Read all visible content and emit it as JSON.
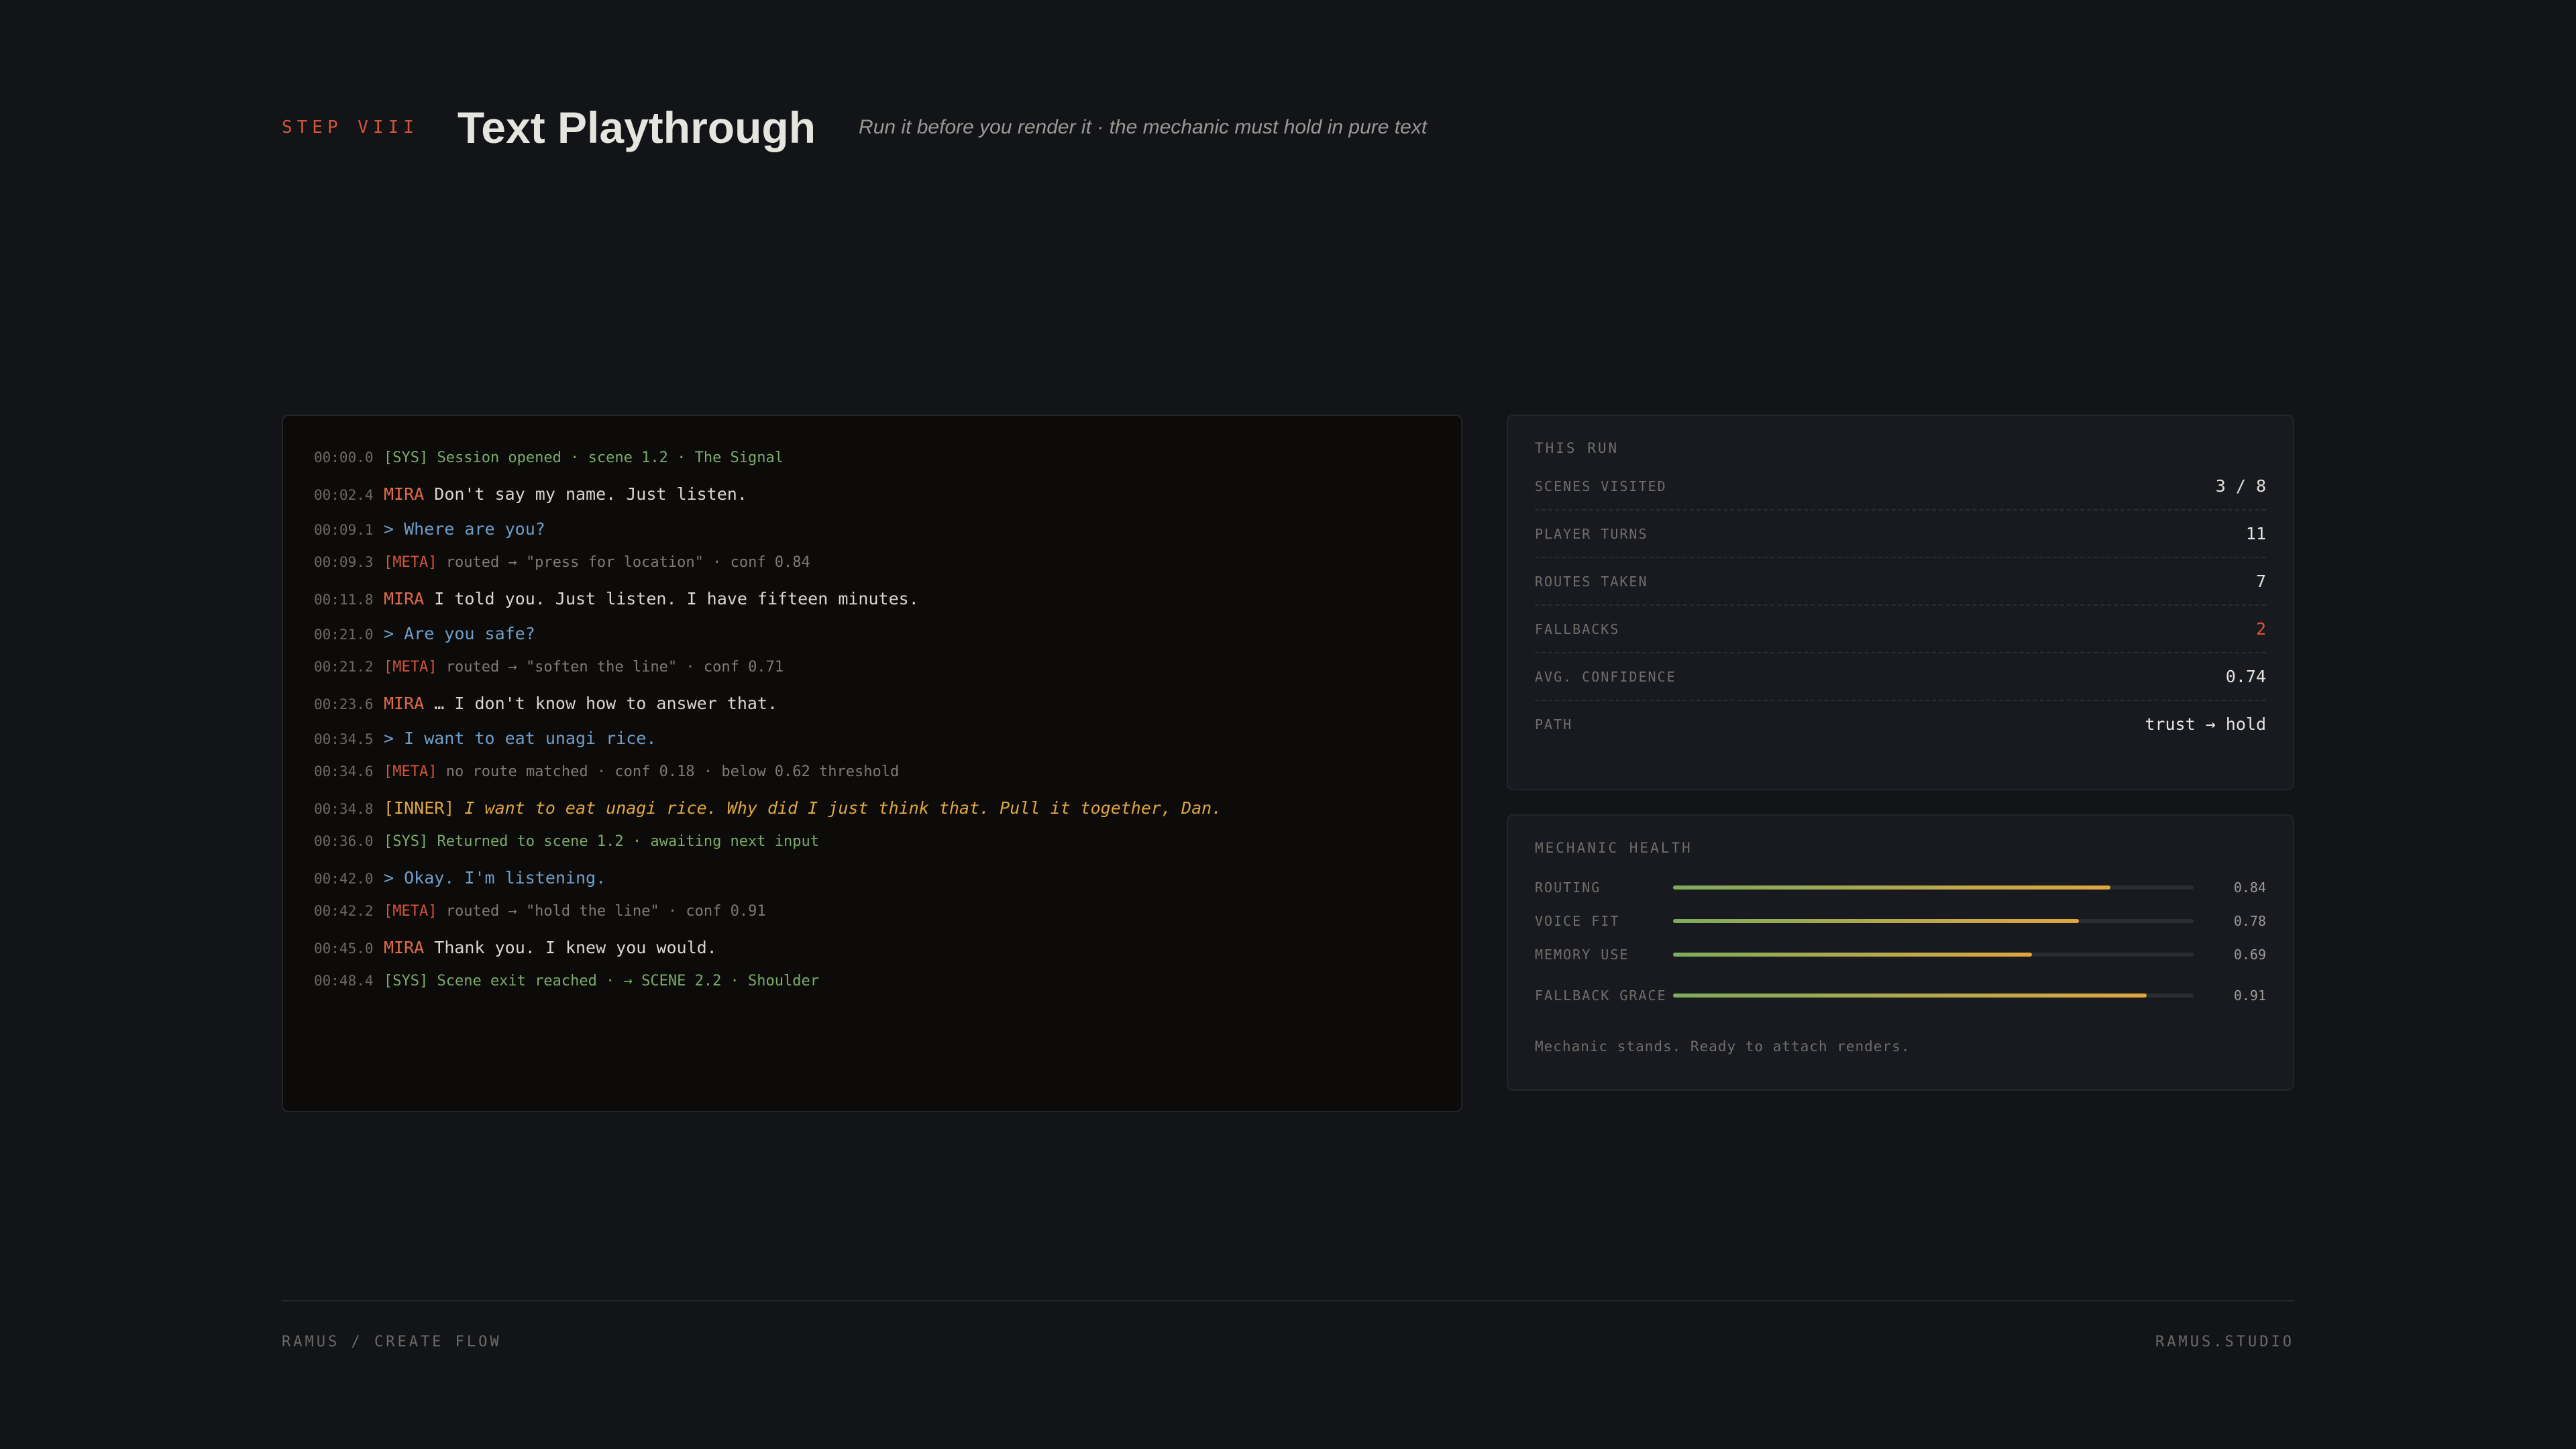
{
  "header": {
    "step": "STEP VIII",
    "title": "Text Playthrough",
    "subtitle": "Run it before you render it · the mechanic must hold in pure text"
  },
  "log": [
    {
      "ts": "00:00.0",
      "type": "sys",
      "text": "[SYS] Session opened · scene 1.2 · The Signal"
    },
    {
      "ts": "00:02.4",
      "type": "mira",
      "speaker": "MIRA",
      "text": "Don't say my name. Just listen."
    },
    {
      "ts": "00:09.1",
      "type": "player",
      "text": "> Where are you?"
    },
    {
      "ts": "00:09.3",
      "type": "meta",
      "tag": "[META]",
      "text": "routed → \"press for location\" · conf 0.84"
    },
    {
      "ts": "00:11.8",
      "type": "mira",
      "speaker": "MIRA",
      "text": "I told you. Just listen. I have fifteen minutes."
    },
    {
      "ts": "00:21.0",
      "type": "player",
      "text": "> Are you safe?"
    },
    {
      "ts": "00:21.2",
      "type": "meta",
      "tag": "[META]",
      "text": "routed → \"soften the line\" · conf 0.71"
    },
    {
      "ts": "00:23.6",
      "type": "mira",
      "speaker": "MIRA",
      "text": "… I don't know how to answer that."
    },
    {
      "ts": "00:34.5",
      "type": "player",
      "text": "> I want to eat unagi rice."
    },
    {
      "ts": "00:34.6",
      "type": "meta",
      "tag": "[META]",
      "text": "no route matched · conf 0.18 · below 0.62 threshold"
    },
    {
      "ts": "00:34.8",
      "type": "inner",
      "tag": "[INNER]",
      "text": "I want to eat unagi rice. Why did I just think that. Pull it together, Dan."
    },
    {
      "ts": "00:36.0",
      "type": "sys",
      "text": "[SYS] Returned to scene 1.2 · awaiting next input"
    },
    {
      "ts": "00:42.0",
      "type": "player",
      "text": "> Okay. I'm listening."
    },
    {
      "ts": "00:42.2",
      "type": "meta",
      "tag": "[META]",
      "text": "routed → \"hold the line\" · conf 0.91"
    },
    {
      "ts": "00:45.0",
      "type": "mira",
      "speaker": "MIRA",
      "text": "Thank you. I knew you would."
    },
    {
      "ts": "00:48.4",
      "type": "sys",
      "text": "[SYS] Scene exit reached · → SCENE 2.2 · Shoulder"
    }
  ],
  "this_run": {
    "title": "THIS RUN",
    "stats": [
      {
        "label": "SCENES VISITED",
        "value": "3 / 8"
      },
      {
        "label": "PLAYER TURNS",
        "value": "11"
      },
      {
        "label": "ROUTES TAKEN",
        "value": "7"
      },
      {
        "label": "FALLBACKS",
        "value": "2"
      },
      {
        "label": "AVG. CONFIDENCE",
        "value": "0.74"
      },
      {
        "label": "PATH",
        "value": "trust → hold"
      }
    ]
  },
  "health": {
    "title": "MECHANIC HEALTH",
    "rows": [
      {
        "label": "ROUTING",
        "value": "0.84",
        "level": 0.84
      },
      {
        "label": "VOICE FIT",
        "value": "0.78",
        "level": 0.78
      },
      {
        "label": "MEMORY USE",
        "value": "0.69",
        "level": 0.69
      },
      {
        "label": "FALLBACK GRACE",
        "value": "0.91",
        "level": 0.91
      }
    ],
    "note": "Mechanic stands. Ready to attach renders."
  },
  "footer": {
    "left": "RAMUS / CREATE FLOW",
    "right": "RAMUS.STUDIO"
  },
  "colors": {
    "accent": "#d4553d",
    "sys": "#7bab6a",
    "player": "#6f9ec8",
    "inner": "#e0a640",
    "warn": "#e0553a"
  }
}
